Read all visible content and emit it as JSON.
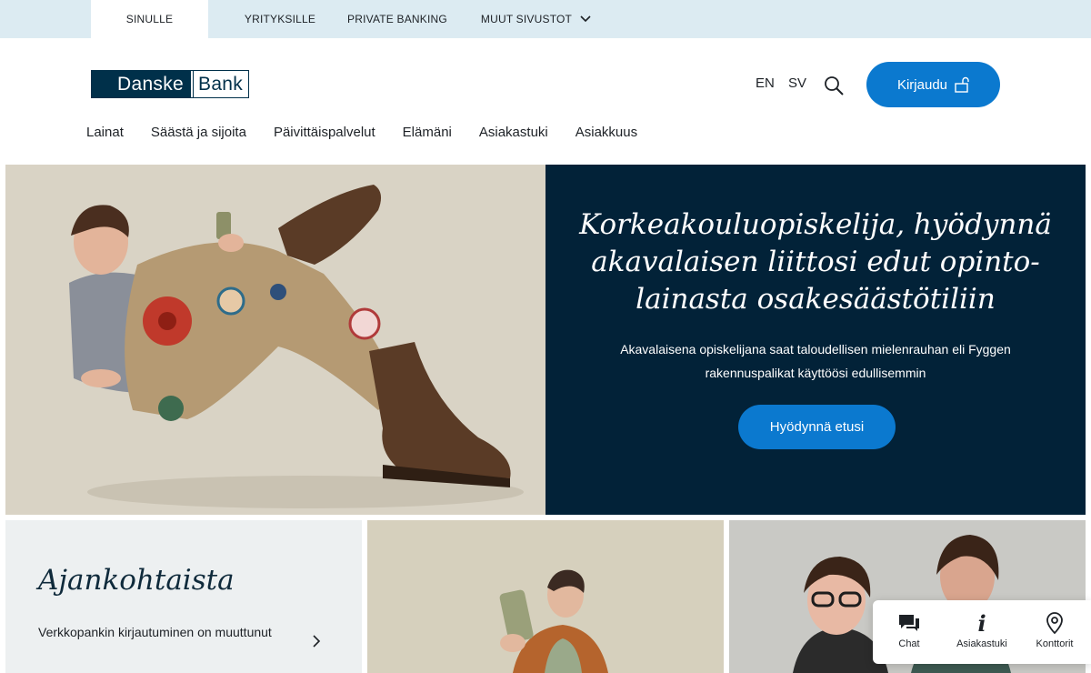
{
  "topbar": {
    "tabs": [
      {
        "label": "SINULLE",
        "active": true
      },
      {
        "label": "YRITYKSILLE",
        "active": false
      },
      {
        "label": "PRIVATE BANKING",
        "active": false
      },
      {
        "label": "MUUT SIVUSTOT",
        "active": false
      }
    ]
  },
  "header": {
    "logo_part1": "Danske",
    "logo_part2": "Bank",
    "lang_en": "EN",
    "lang_sv": "SV",
    "login_label": "Kirjaudu"
  },
  "mainnav": [
    "Lainat",
    "Säästä ja sijoita",
    "Päivittäispalvelut",
    "Elämäni",
    "Asiakastuki",
    "Asiakkuus"
  ],
  "hero": {
    "title": "Korkeakouluopiskelija, hyödynnä akavalaisen liittosi edut opinto-lainasta osakesäästötiliin",
    "subtitle": "Akavalaisena opiskelijana saat taloudellisen mielenrauhan eli Fyggen rakennuspalikat käyttöösi edullisemmin",
    "cta": "Hyödynnä etusi"
  },
  "news": {
    "title": "Ajankohtaista",
    "link": "Verkkopankin kirjautuminen on muuttunut"
  },
  "widget": {
    "chat": "Chat",
    "support": "Asiakastuki",
    "offices": "Konttorit"
  },
  "colors": {
    "accent": "#0b79cf",
    "navy": "#022238",
    "topbar": "#dcebf2"
  }
}
